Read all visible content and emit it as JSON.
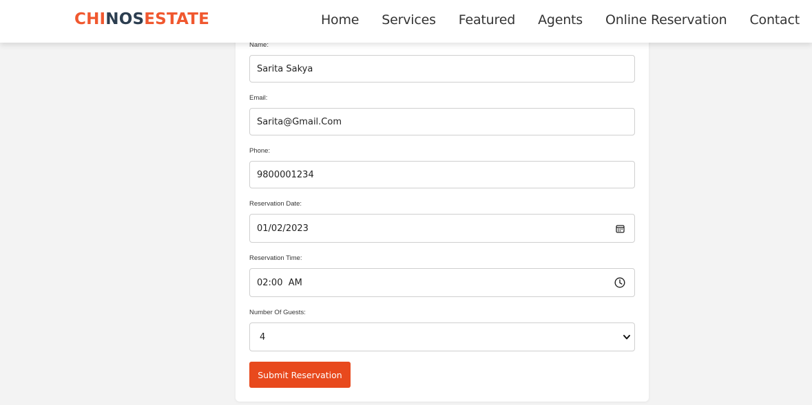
{
  "brand": {
    "part1": "CHI",
    "part2": "NOS",
    "part3": "ESTATE",
    "accent_color": "#f0582f",
    "dark_color": "#2c3e50"
  },
  "nav": {
    "items": [
      "Home",
      "Services",
      "Featured",
      "Agents",
      "Online Reservation",
      "Contact"
    ]
  },
  "form": {
    "name_label": "Name:",
    "name_value": "Sarita Sakya",
    "email_label": "Email:",
    "email_value": "Sarita@Gmail.Com",
    "phone_label": "Phone:",
    "phone_value": "9800001234",
    "date_label": "Reservation Date:",
    "date_value": "01/02/2023",
    "date_icon": "calendar-icon",
    "time_label": "Reservation Time:",
    "time_value": "02:00  AM",
    "time_icon": "clock-icon",
    "guests_label": "Number Of Guests:",
    "guests_value": "4",
    "guests_icon": "chevron-down-icon",
    "submit_label": "Submit Reservation",
    "submit_color": "#e8491d"
  }
}
